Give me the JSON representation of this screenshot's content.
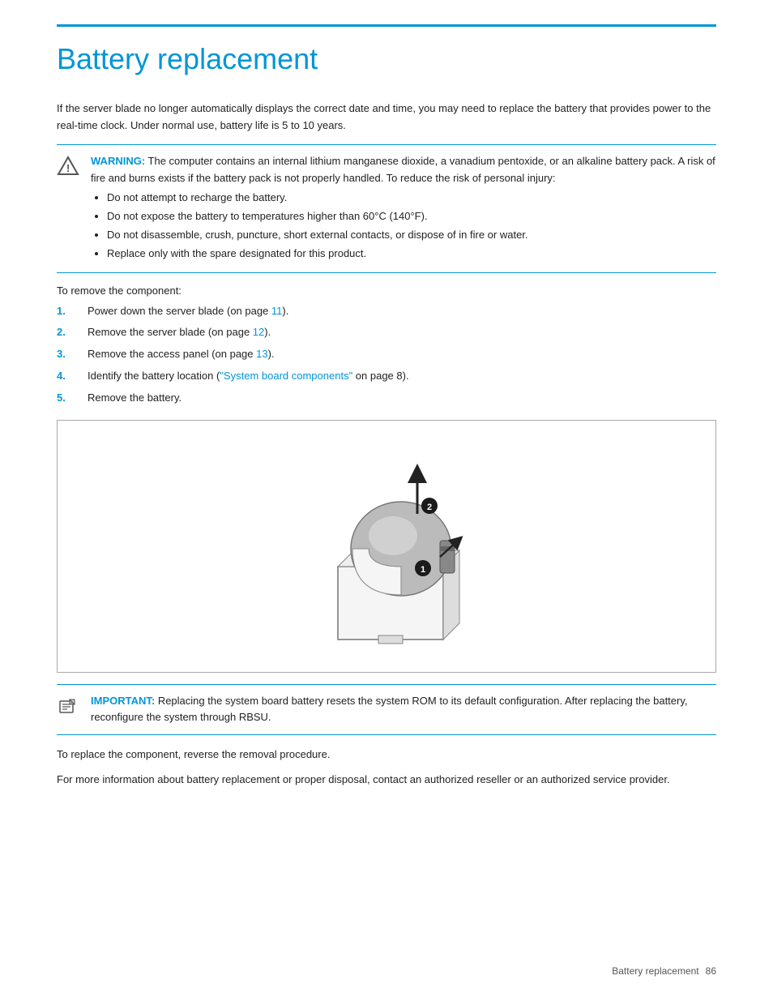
{
  "page": {
    "title": "Battery replacement",
    "top_rule": true,
    "footer": {
      "text": "Battery replacement",
      "page_num": "86"
    }
  },
  "intro": {
    "text": "If the server blade no longer automatically displays the correct date and time, you may need to replace the battery that provides power to the real-time clock. Under normal use, battery life is 5 to 10 years."
  },
  "warning": {
    "label": "WARNING:",
    "text": " The computer contains an internal lithium manganese dioxide, a vanadium pentoxide, or an alkaline battery pack. A risk of fire and burns exists if the battery pack is not properly handled. To reduce the risk of personal injury:",
    "bullets": [
      "Do not attempt to recharge the battery.",
      "Do not expose the battery to temperatures higher than 60°C (140°F).",
      "Do not disassemble, crush, puncture, short external contacts, or dispose of in fire or water.",
      "Replace only with the spare designated for this product."
    ]
  },
  "steps_intro": "To remove the component:",
  "steps": [
    {
      "num": "1.",
      "text": "Power down the server blade (on page ",
      "link_text": "11",
      "link_page": "11",
      "text_after": ")."
    },
    {
      "num": "2.",
      "text": "Remove the server blade (on page ",
      "link_text": "12",
      "link_page": "12",
      "text_after": ")."
    },
    {
      "num": "3.",
      "text": "Remove the access panel (on page ",
      "link_text": "13",
      "link_page": "13",
      "text_after": ")."
    },
    {
      "num": "4.",
      "text": "Identify the battery location (",
      "link_text": "\"System board components\"",
      "link_page": "8",
      "text_after": " on page 8)."
    },
    {
      "num": "5.",
      "text": "Remove the battery.",
      "link_text": null
    }
  ],
  "important": {
    "label": "IMPORTANT:",
    "text": " Replacing the system board battery resets the system ROM to its default configuration. After replacing the battery, reconfigure the system through RBSU."
  },
  "footer_texts": [
    "To replace the component, reverse the removal procedure.",
    "For more information about battery replacement or proper disposal, contact an authorized reseller or an authorized service provider."
  ]
}
